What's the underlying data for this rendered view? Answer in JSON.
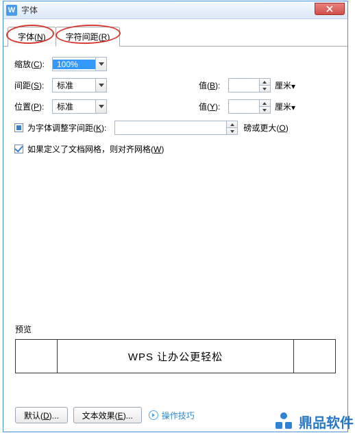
{
  "window": {
    "title": "字体",
    "icon_letter": "W"
  },
  "tabs": {
    "font": "字体(N)",
    "spacing": "字符间距(R)",
    "active": "spacing"
  },
  "form": {
    "scale_label": "缩放(C):",
    "scale_value": "100%",
    "spacing_label": "间距(S):",
    "spacing_value": "标准",
    "value_b_label": "值(B):",
    "value_b_value": "",
    "position_label": "位置(P):",
    "position_value": "标准",
    "value_y_label": "值(Y):",
    "value_y_value": "",
    "unit_cm": "厘米",
    "kerning_label": "为字体调整字间距(K):",
    "kerning_value": "",
    "kerning_unit": "磅或更大(O)",
    "grid_label": "如果定义了文档网格，则对齐网格(W)"
  },
  "preview": {
    "label": "预览",
    "text": "WPS 让办公更轻松"
  },
  "buttons": {
    "default": "默认(D)...",
    "text_effect": "文本效果(E)...",
    "tips": "操作技巧"
  },
  "brand": {
    "name": "鼎品软件"
  }
}
